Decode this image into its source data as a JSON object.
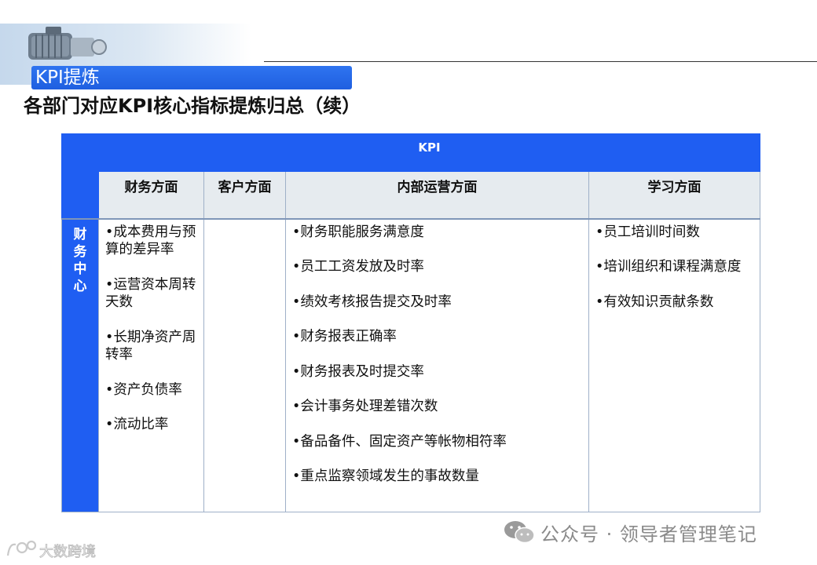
{
  "banner": {
    "tag": "KPI提炼"
  },
  "title": "各部门对应KPI核心指标提炼归总（续）",
  "table": {
    "kpi_header": "KPI",
    "columns": [
      "财务方面",
      "客户方面",
      "内部运营方面",
      "学习方面"
    ],
    "row_label": "财\n务\n中\n心",
    "finance": [
      "•成本费用与预算的差异率",
      "•运营资本周转天数",
      "•长期净资产周转率",
      "•资产负债率",
      "•流动比率"
    ],
    "customer": [],
    "internal": [
      "•财务职能服务满意度",
      "•员工工资发放及时率",
      "•绩效考核报告提交及时率",
      "•财务报表正确率",
      "•财务报表及时提交率",
      "•会计事务处理差错次数",
      "•备品备件、固定资产等帐物相符率",
      "•重点监察领域发生的事故数量"
    ],
    "learning": [
      "•员工培训时间数",
      "•培训组织和课程满意度",
      "•有效知识贡献条数"
    ]
  },
  "watermark": {
    "text": "公众号 · 领导者管理笔记",
    "icon": "wechat-icon"
  },
  "logo": {
    "text": "大数跨境",
    "icon": "logo-mark"
  }
}
